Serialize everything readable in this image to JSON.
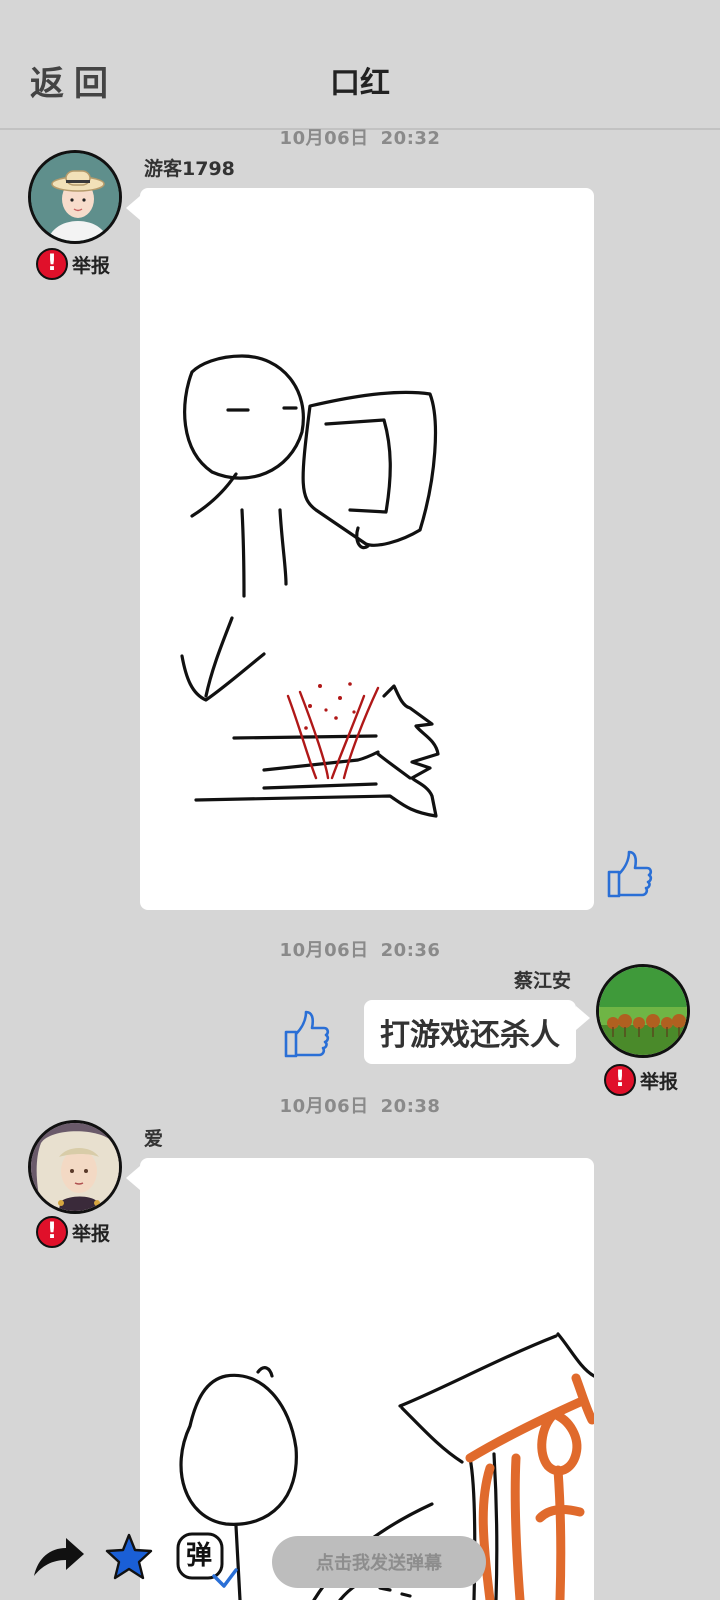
{
  "header": {
    "back_label": "返回",
    "title": "口红"
  },
  "messages": [
    {
      "time_date": "10月06日",
      "time_clock": "20:32",
      "username": "游客1798",
      "report_label": "举报",
      "type": "image"
    },
    {
      "time_date": "10月06日",
      "time_clock": "20:36",
      "username": "蔡江安",
      "report_label": "举报",
      "type": "text",
      "text": "打游戏还杀人"
    },
    {
      "time_date": "10月06日",
      "time_clock": "20:38",
      "username": "爱",
      "report_label": "举报",
      "type": "image"
    }
  ],
  "bottom_bar": {
    "danmu_placeholder": "点击我发送弹幕",
    "danmu_icon_char": "弹"
  },
  "icons": {
    "report": "alert-icon",
    "like": "thumbs-up-icon",
    "share": "share-icon",
    "star": "star-icon",
    "danmu": "danmu-icon"
  },
  "colors": {
    "background": "#d6d6d6",
    "report_red": "#e0102a",
    "like_blue": "#2a6fd6",
    "star_blue": "#1a5fd6",
    "blood_red": "#b01818",
    "drawing_orange": "#e06a2c"
  }
}
